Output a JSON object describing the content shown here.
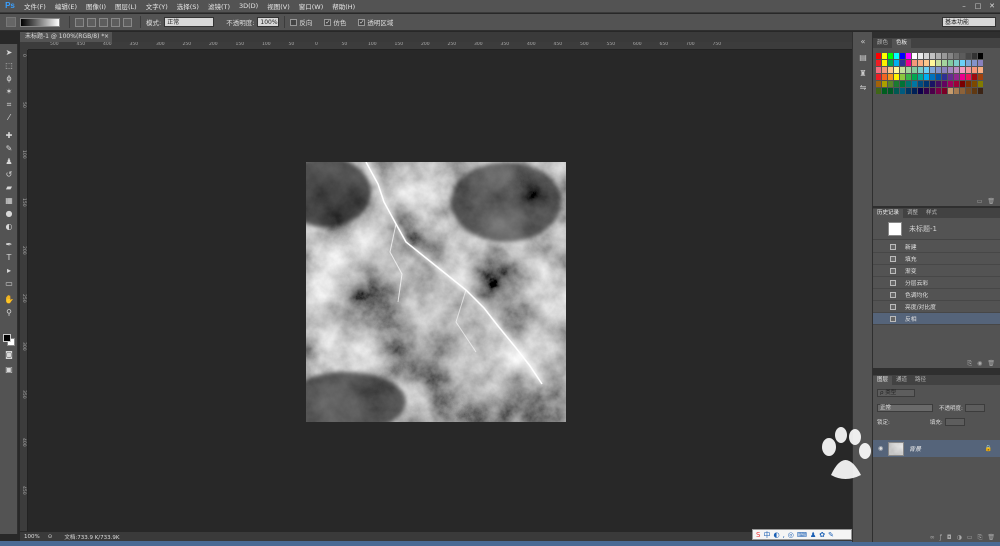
{
  "app": {
    "logo": "Ps",
    "menu": [
      "文件(F)",
      "编辑(E)",
      "图像(I)",
      "图层(L)",
      "文字(Y)",
      "选择(S)",
      "滤镜(T)",
      "3D(D)",
      "视图(V)",
      "窗口(W)",
      "帮助(H)"
    ],
    "window_controls": [
      "–",
      "□",
      "✕"
    ]
  },
  "options": {
    "mode_label": "模式:",
    "mode_value": "正常",
    "opacity_label": "不透明度:",
    "opacity_value": "100%",
    "checkboxes": [
      {
        "label": "反向",
        "checked": false
      },
      {
        "label": "仿色",
        "checked": true
      },
      {
        "label": "透明区域",
        "checked": true
      }
    ],
    "workspace": "基本功能"
  },
  "document": {
    "tab_title": "未标题-1 @ 100%(RGB/8) *",
    "close": "×"
  },
  "rulers": {
    "h": [
      "500",
      "450",
      "400",
      "350",
      "300",
      "250",
      "200",
      "150",
      "100",
      "50",
      "0",
      "50",
      "100",
      "150",
      "200",
      "250",
      "300",
      "350",
      "400",
      "450",
      "500",
      "550",
      "600",
      "650",
      "700",
      "750"
    ],
    "v": [
      "0",
      "50",
      "100",
      "150",
      "200",
      "250",
      "300",
      "350",
      "400",
      "450"
    ]
  },
  "status": {
    "zoom": "100%",
    "doc_size": "文档:733.9 K/733.9K"
  },
  "panels": {
    "swatches_tabs": [
      "颜色",
      "色板"
    ],
    "history_tabs": [
      "历史记录",
      "调整",
      "样式"
    ],
    "history_snapshot": "未标题-1",
    "history_items": [
      "新建",
      "填充",
      "渐变",
      "分层云彩",
      "色调均化",
      "亮度/对比度",
      "反相"
    ],
    "layers_tabs": [
      "图层",
      "通道",
      "路径"
    ],
    "layer_kind": "ρ 类型",
    "blend_mode": "正常",
    "opacity_label": "不透明度:",
    "lock_label": "锁定:",
    "fill_label": "填充:",
    "layer_name": "背景"
  },
  "swatch_colors": [
    [
      "#ff0000",
      "#ffff00",
      "#00ff00",
      "#00ffff",
      "#0000ff",
      "#ff00ff",
      "#ffffff",
      "#ebebeb",
      "#d6d6d6",
      "#c2c2c2",
      "#adadad",
      "#999999",
      "#858585",
      "#707070",
      "#5c5c5c",
      "#474747",
      "#333333",
      "#000000"
    ],
    [
      "#ee1d24",
      "#fff100",
      "#00a650",
      "#00aeef",
      "#2f3192",
      "#ed008c",
      "#f7977a",
      "#fbad82",
      "#fdc68c",
      "#fff799",
      "#c6df9c",
      "#a4d49d",
      "#81ca9d",
      "#7bcdc9",
      "#6ccff7",
      "#7ca6d8",
      "#8293ca",
      "#8881be"
    ],
    [
      "#f26d7d",
      "#f69679",
      "#fdc689",
      "#fff79a",
      "#c4df9b",
      "#a3d39c",
      "#82ca9c",
      "#7accc8",
      "#6dcff6",
      "#7da7d9",
      "#8493ca",
      "#8882be",
      "#a187be",
      "#bc8cbf",
      "#f49ac1",
      "#f5989d",
      "#f7977a",
      "#f9ad81"
    ],
    [
      "#ed1c24",
      "#f26522",
      "#f7941d",
      "#fff200",
      "#8dc63f",
      "#39b54a",
      "#00a651",
      "#00a99d",
      "#00aeef",
      "#0072bc",
      "#0054a6",
      "#2e3192",
      "#662d91",
      "#92278f",
      "#ec008c",
      "#ed145b",
      "#9e0b0f",
      "#a0410d"
    ],
    [
      "#a36209",
      "#aba000",
      "#598527",
      "#1a7b30",
      "#007236",
      "#00746b",
      "#0076a3",
      "#004b80",
      "#003471",
      "#1b1464",
      "#440e62",
      "#630460",
      "#9e005d",
      "#9e0039",
      "#790000",
      "#7b2e00",
      "#7d4900",
      "#827b00"
    ],
    [
      "#406618",
      "#005e20",
      "#005826",
      "#005952",
      "#005b7f",
      "#003663",
      "#002157",
      "#0d004c",
      "#32004b",
      "#4b0049",
      "#7b0046",
      "#7a0026",
      "#c69c6d",
      "#a67c52",
      "#8c6239",
      "#754c24",
      "#603913",
      "#3c2415"
    ]
  ]
}
